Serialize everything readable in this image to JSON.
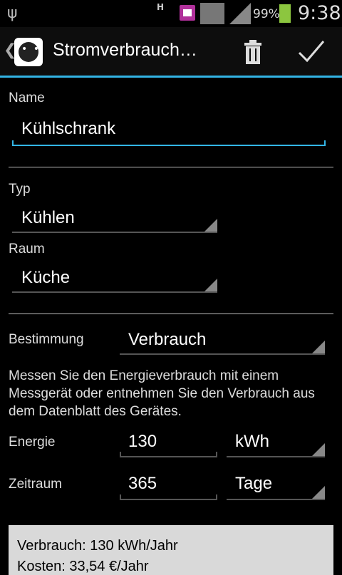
{
  "status_bar": {
    "network": "H",
    "battery_percent": "99%",
    "time": "9:38"
  },
  "action_bar": {
    "title": "Stromverbrauch…"
  },
  "form": {
    "name_label": "Name",
    "name_value": "Kühlschrank",
    "typ_label": "Typ",
    "typ_value": "Kühlen",
    "raum_label": "Raum",
    "raum_value": "Küche",
    "bestimmung_label": "Bestimmung",
    "bestimmung_value": "Verbrauch",
    "description": "Messen Sie den Energieverbrauch mit einem Messgerät oder entnehmen Sie den Verbrauch aus dem Datenblatt des Gerätes.",
    "energie_label": "Energie",
    "energie_value": "130",
    "energie_unit": "kWh",
    "zeitraum_label": "Zeitraum",
    "zeitraum_value": "365",
    "zeitraum_unit": "Tage"
  },
  "summary": {
    "line1": "Verbrauch: 130 kWh/Jahr",
    "line2": "Kosten: 33,54 €/Jahr"
  },
  "colors": {
    "accent": "#33b5e5",
    "background": "#000000",
    "summary_bg": "#d9d9d9"
  }
}
